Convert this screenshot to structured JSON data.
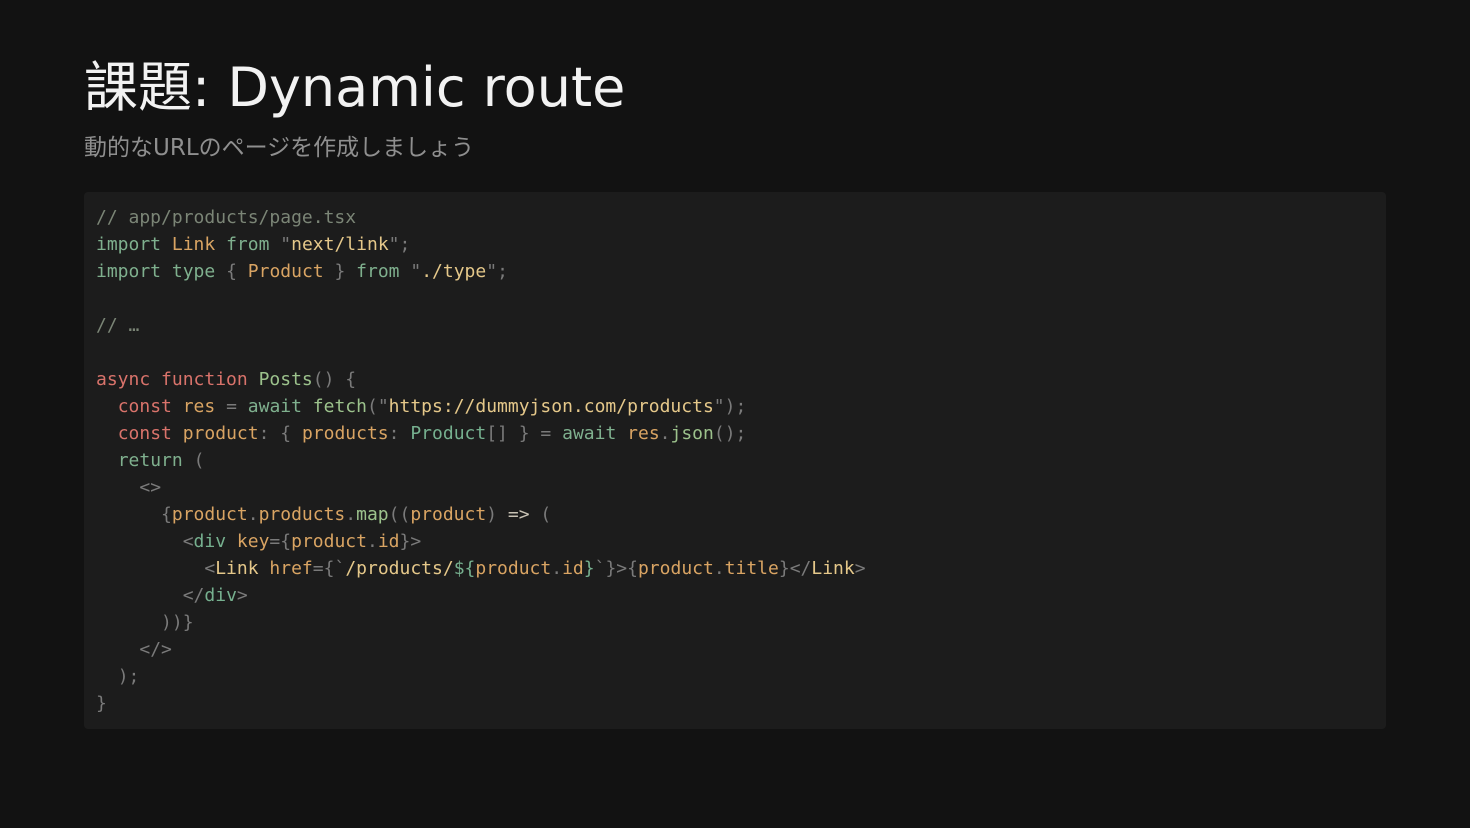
{
  "slide": {
    "title": "課題: Dynamic route",
    "subtitle": "動的なURLのページを作成しましょう"
  },
  "colors": {
    "background": "#121212",
    "code_background": "#1c1c1c",
    "comment": "#7b8576",
    "keyword_green": "#7fb08e",
    "keyword_red": "#d9736b",
    "identifier": "#d9a463",
    "string": "#c6b37f",
    "function": "#9cc28c",
    "punctuation": "#7a7a7a"
  },
  "code": {
    "lines": [
      [
        {
          "t": "// app/products/page.tsx",
          "k": "comment"
        }
      ],
      [
        {
          "t": "import",
          "k": "kw-green"
        },
        {
          "t": " ",
          "k": "text"
        },
        {
          "t": "Link",
          "k": "ident"
        },
        {
          "t": " ",
          "k": "text"
        },
        {
          "t": "from",
          "k": "kw-green"
        },
        {
          "t": " ",
          "k": "text"
        },
        {
          "t": "\"",
          "k": "punct"
        },
        {
          "t": "next/link",
          "k": "str-lite"
        },
        {
          "t": "\"",
          "k": "punct"
        },
        {
          "t": ";",
          "k": "punct"
        }
      ],
      [
        {
          "t": "import",
          "k": "kw-green"
        },
        {
          "t": " ",
          "k": "text"
        },
        {
          "t": "type",
          "k": "kw-green"
        },
        {
          "t": " ",
          "k": "text"
        },
        {
          "t": "{",
          "k": "punct"
        },
        {
          "t": " ",
          "k": "text"
        },
        {
          "t": "Product",
          "k": "ident"
        },
        {
          "t": " ",
          "k": "text"
        },
        {
          "t": "}",
          "k": "punct"
        },
        {
          "t": " ",
          "k": "text"
        },
        {
          "t": "from",
          "k": "kw-green"
        },
        {
          "t": " ",
          "k": "text"
        },
        {
          "t": "\"",
          "k": "punct"
        },
        {
          "t": "./type",
          "k": "str-lite"
        },
        {
          "t": "\"",
          "k": "punct"
        },
        {
          "t": ";",
          "k": "punct"
        }
      ],
      [],
      [
        {
          "t": "// …",
          "k": "comment"
        }
      ],
      [],
      [
        {
          "t": "async",
          "k": "kw-red"
        },
        {
          "t": " ",
          "k": "text"
        },
        {
          "t": "function",
          "k": "kw-red"
        },
        {
          "t": " ",
          "k": "text"
        },
        {
          "t": "Posts",
          "k": "func"
        },
        {
          "t": "()",
          "k": "punct"
        },
        {
          "t": " ",
          "k": "text"
        },
        {
          "t": "{",
          "k": "punct"
        }
      ],
      [
        {
          "t": "  ",
          "k": "text"
        },
        {
          "t": "const",
          "k": "kw-red"
        },
        {
          "t": " ",
          "k": "text"
        },
        {
          "t": "res",
          "k": "ident"
        },
        {
          "t": " ",
          "k": "text"
        },
        {
          "t": "=",
          "k": "punct"
        },
        {
          "t": " ",
          "k": "text"
        },
        {
          "t": "await",
          "k": "kw-green"
        },
        {
          "t": " ",
          "k": "text"
        },
        {
          "t": "fetch",
          "k": "func"
        },
        {
          "t": "(",
          "k": "punct"
        },
        {
          "t": "\"",
          "k": "punct"
        },
        {
          "t": "https://dummyjson.com/products",
          "k": "str-lite"
        },
        {
          "t": "\"",
          "k": "punct"
        },
        {
          "t": ");",
          "k": "punct"
        }
      ],
      [
        {
          "t": "  ",
          "k": "text"
        },
        {
          "t": "const",
          "k": "kw-red"
        },
        {
          "t": " ",
          "k": "text"
        },
        {
          "t": "product",
          "k": "ident"
        },
        {
          "t": ":",
          "k": "punct"
        },
        {
          "t": " ",
          "k": "text"
        },
        {
          "t": "{",
          "k": "punct"
        },
        {
          "t": " ",
          "k": "text"
        },
        {
          "t": "products",
          "k": "ident"
        },
        {
          "t": ":",
          "k": "punct"
        },
        {
          "t": " ",
          "k": "text"
        },
        {
          "t": "Product",
          "k": "type"
        },
        {
          "t": "[]",
          "k": "punct"
        },
        {
          "t": " ",
          "k": "text"
        },
        {
          "t": "}",
          "k": "punct"
        },
        {
          "t": " ",
          "k": "text"
        },
        {
          "t": "=",
          "k": "punct"
        },
        {
          "t": " ",
          "k": "text"
        },
        {
          "t": "await",
          "k": "kw-green"
        },
        {
          "t": " ",
          "k": "text"
        },
        {
          "t": "res",
          "k": "ident"
        },
        {
          "t": ".",
          "k": "punct"
        },
        {
          "t": "json",
          "k": "func"
        },
        {
          "t": "();",
          "k": "punct"
        }
      ],
      [
        {
          "t": "  ",
          "k": "text"
        },
        {
          "t": "return",
          "k": "kw-green"
        },
        {
          "t": " ",
          "k": "text"
        },
        {
          "t": "(",
          "k": "punct"
        }
      ],
      [
        {
          "t": "    ",
          "k": "text"
        },
        {
          "t": "<>",
          "k": "punct"
        }
      ],
      [
        {
          "t": "      ",
          "k": "text"
        },
        {
          "t": "{",
          "k": "punct"
        },
        {
          "t": "product",
          "k": "ident"
        },
        {
          "t": ".",
          "k": "punct"
        },
        {
          "t": "products",
          "k": "ident"
        },
        {
          "t": ".",
          "k": "punct"
        },
        {
          "t": "map",
          "k": "func"
        },
        {
          "t": "((",
          "k": "punct"
        },
        {
          "t": "product",
          "k": "ident"
        },
        {
          "t": ")",
          "k": "punct"
        },
        {
          "t": " ",
          "k": "text"
        },
        {
          "t": "=>",
          "k": "text"
        },
        {
          "t": " ",
          "k": "text"
        },
        {
          "t": "(",
          "k": "punct"
        }
      ],
      [
        {
          "t": "        ",
          "k": "text"
        },
        {
          "t": "<",
          "k": "punct"
        },
        {
          "t": "div",
          "k": "type"
        },
        {
          "t": " ",
          "k": "text"
        },
        {
          "t": "key",
          "k": "ident"
        },
        {
          "t": "={",
          "k": "punct"
        },
        {
          "t": "product",
          "k": "ident"
        },
        {
          "t": ".",
          "k": "punct"
        },
        {
          "t": "id",
          "k": "ident"
        },
        {
          "t": "}>",
          "k": "punct"
        }
      ],
      [
        {
          "t": "          ",
          "k": "text"
        },
        {
          "t": "<",
          "k": "punct"
        },
        {
          "t": "Link",
          "k": "str-lite"
        },
        {
          "t": " ",
          "k": "text"
        },
        {
          "t": "href",
          "k": "ident"
        },
        {
          "t": "={",
          "k": "punct"
        },
        {
          "t": "`",
          "k": "punct"
        },
        {
          "t": "/products/",
          "k": "str-lite"
        },
        {
          "t": "${",
          "k": "type"
        },
        {
          "t": "product",
          "k": "ident"
        },
        {
          "t": ".",
          "k": "punct"
        },
        {
          "t": "id",
          "k": "ident"
        },
        {
          "t": "}",
          "k": "type"
        },
        {
          "t": "`",
          "k": "punct"
        },
        {
          "t": "}>{",
          "k": "punct"
        },
        {
          "t": "product",
          "k": "ident"
        },
        {
          "t": ".",
          "k": "punct"
        },
        {
          "t": "title",
          "k": "ident"
        },
        {
          "t": "}</",
          "k": "punct"
        },
        {
          "t": "Link",
          "k": "str-lite"
        },
        {
          "t": ">",
          "k": "punct"
        }
      ],
      [
        {
          "t": "        ",
          "k": "text"
        },
        {
          "t": "</",
          "k": "punct"
        },
        {
          "t": "div",
          "k": "type"
        },
        {
          "t": ">",
          "k": "punct"
        }
      ],
      [
        {
          "t": "      ",
          "k": "text"
        },
        {
          "t": "))}",
          "k": "punct"
        }
      ],
      [
        {
          "t": "    ",
          "k": "text"
        },
        {
          "t": "</>",
          "k": "punct"
        }
      ],
      [
        {
          "t": "  ",
          "k": "text"
        },
        {
          "t": ");",
          "k": "punct"
        }
      ],
      [
        {
          "t": "}",
          "k": "punct"
        }
      ]
    ]
  }
}
